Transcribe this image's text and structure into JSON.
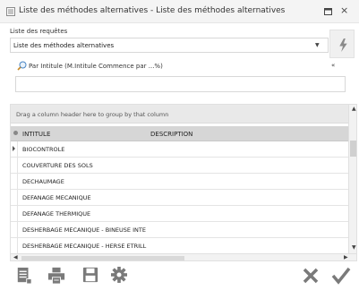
{
  "window": {
    "title": "Liste des méthodes alternatives - Liste des méthodes alternatives"
  },
  "requetes": {
    "label": "Liste des requêtes",
    "selected": "Liste des méthodes alternatives"
  },
  "filter": {
    "hint": "Par Intitule (M.Intitule Commence par ...%)",
    "value": ""
  },
  "grid": {
    "group_hint": "Drag a column header here to group by that column",
    "columns": [
      "INTITULE",
      "DESCRIPTION"
    ],
    "rows": [
      "BIOCONTROLE",
      "COUVERTURE DES SOLS",
      "DECHAUMAGE",
      "DEFANAGE MECANIQUE",
      "DEFANAGE THERMIQUE",
      "DESHERBAGE MECANIQUE - BINEUSE INTE",
      "DESHERBAGE MECANIQUE - HERSE ETRILL"
    ],
    "vertical_scroll_fraction": 0.12,
    "horizontal_scroll_fraction": 0.0
  },
  "colors": {
    "icon_gray": "#7a7a7a",
    "header_bg": "#d6d6d6",
    "group_bg": "#e9e9e9"
  },
  "icons": {
    "app": "list-icon",
    "execute": "lightning-icon",
    "search": "magnifier-icon",
    "collapse": "double-chevron-up-icon",
    "toolbar": [
      "report-icon",
      "printer-icon",
      "save-icon",
      "gear-icon"
    ],
    "cancel": "close-x-icon",
    "ok": "check-icon"
  }
}
